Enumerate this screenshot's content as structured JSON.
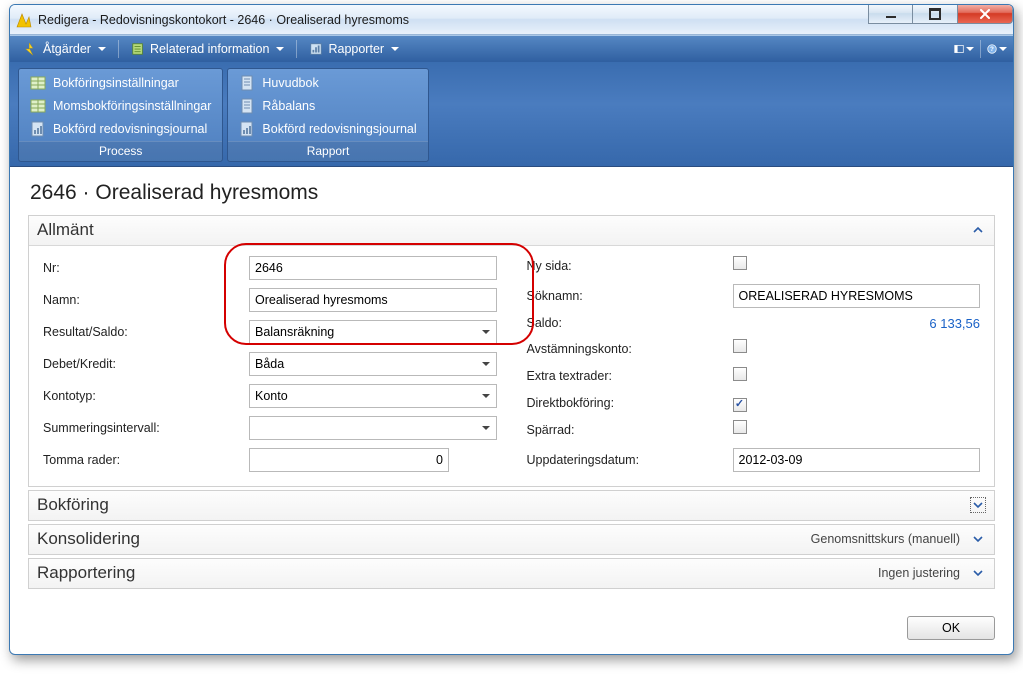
{
  "titlebar": "Redigera - Redovisningskontokort - 2646 · Orealiserad hyresmoms",
  "menubar": {
    "actions": "Åtgärder",
    "related": "Relaterad information",
    "reports": "Rapporter"
  },
  "ribbon": {
    "process": {
      "label": "Process",
      "items": [
        "Bokföringsinställningar",
        "Momsbokföringsinställningar",
        "Bokförd redovisningsjournal"
      ]
    },
    "report": {
      "label": "Rapport",
      "items": [
        "Huvudbok",
        "Råbalans",
        "Bokförd redovisningsjournal"
      ]
    }
  },
  "page_title": "2646 · Orealiserad hyresmoms",
  "tabs": {
    "general": {
      "caption": "Allmänt",
      "left": {
        "nr_label": "Nr:",
        "nr_value": "2646",
        "name_label": "Namn:",
        "name_value": "Orealiserad hyresmoms",
        "result_label": "Resultat/Saldo:",
        "result_value": "Balansräkning",
        "dc_label": "Debet/Kredit:",
        "dc_value": "Båda",
        "type_label": "Kontotyp:",
        "type_value": "Konto",
        "sum_label": "Summeringsintervall:",
        "sum_value": "",
        "blank_label": "Tomma rader:",
        "blank_value": "0"
      },
      "right": {
        "newpage_label": "Ny sida:",
        "newpage_checked": false,
        "search_label": "Söknamn:",
        "search_value": "OREALISERAD HYRESMOMS",
        "balance_label": "Saldo:",
        "balance_value": "6 133,56",
        "recon_label": "Avstämningskonto:",
        "recon_checked": false,
        "extra_label": "Extra textrader:",
        "extra_checked": false,
        "direct_label": "Direktbokföring:",
        "direct_checked": true,
        "blocked_label": "Spärrad:",
        "blocked_checked": false,
        "mod_label": "Uppdateringsdatum:",
        "mod_value": "2012-03-09"
      }
    },
    "posting": {
      "caption": "Bokföring"
    },
    "consolidation": {
      "caption": "Konsolidering",
      "summary": "Genomsnittskurs (manuell)"
    },
    "reporting": {
      "caption": "Rapportering",
      "summary": "Ingen justering"
    }
  },
  "footer": {
    "ok": "OK"
  }
}
